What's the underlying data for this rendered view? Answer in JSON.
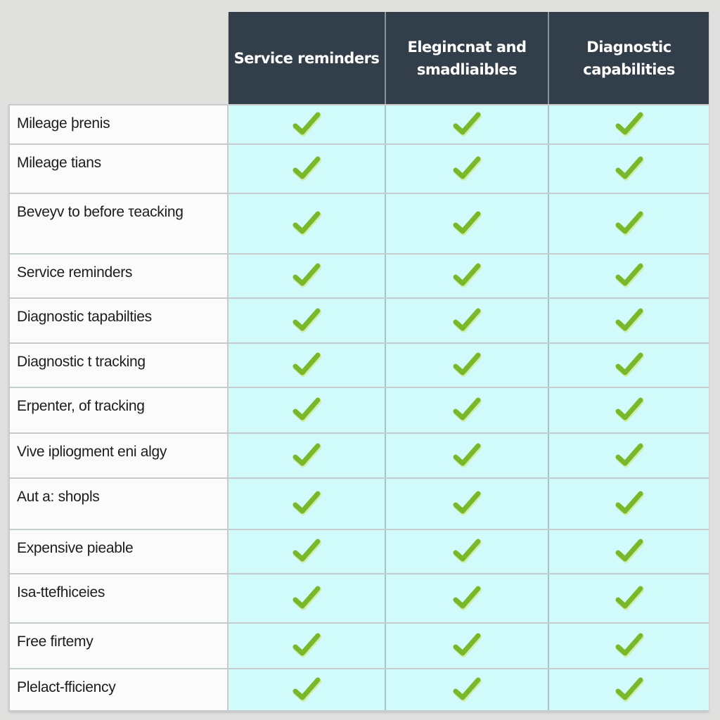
{
  "colors": {
    "background": "#e0e0df",
    "header_bg": "#323e49",
    "header_text": "#ffffff",
    "label_bg": "#fbfbfb",
    "cell_bg": "#d1fafa",
    "check_green": "#78b82a"
  },
  "columns": [
    {
      "label": "Service reminders"
    },
    {
      "label": "Elegincnat and smadliaibles"
    },
    {
      "label": "Diagnostic capabilities"
    }
  ],
  "rows": [
    {
      "label": "Mileage þrenis",
      "checks": [
        true,
        true,
        true
      ]
    },
    {
      "label": "Mileage tians",
      "checks": [
        true,
        true,
        true
      ]
    },
    {
      "label": "Beveyv to before τeacking",
      "checks": [
        true,
        true,
        true
      ]
    },
    {
      "label": "Service reminders",
      "checks": [
        true,
        true,
        true
      ]
    },
    {
      "label": "Diagnostic tapabilties",
      "checks": [
        true,
        true,
        true
      ]
    },
    {
      "label": "Diagnostic t tracking",
      "checks": [
        true,
        true,
        true
      ]
    },
    {
      "label": "Erpenter, of tracking",
      "checks": [
        true,
        true,
        true
      ]
    },
    {
      "label": "Vive ipliogment eni algy",
      "checks": [
        true,
        true,
        true
      ]
    },
    {
      "label": "Aut a: shopls",
      "checks": [
        true,
        true,
        true
      ]
    },
    {
      "label": "Expensive pieable",
      "checks": [
        true,
        true,
        true
      ]
    },
    {
      "label": "Isa-ttefhiceies",
      "checks": [
        true,
        true,
        true
      ]
    },
    {
      "label": "Free firtemy",
      "checks": [
        true,
        true,
        true
      ]
    },
    {
      "label": "Plelact-fficiency",
      "checks": [
        true,
        true,
        true
      ]
    }
  ],
  "icons": {
    "check": "check-icon"
  }
}
